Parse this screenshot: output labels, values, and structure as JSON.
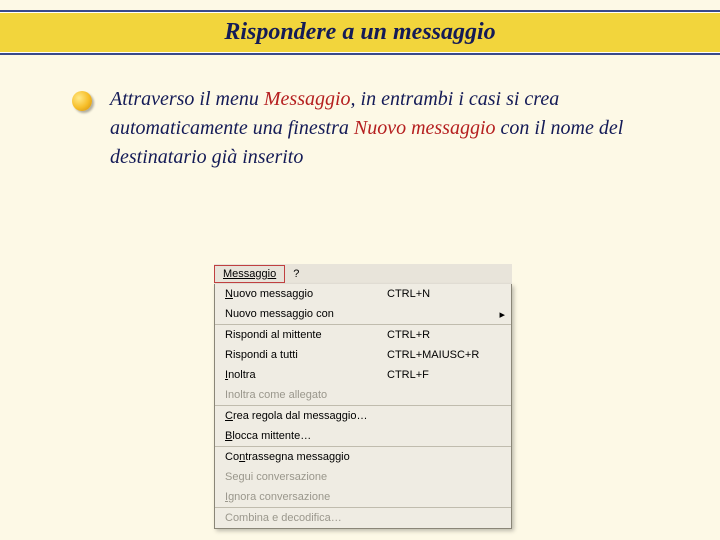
{
  "title": "Rispondere a un messaggio",
  "para": {
    "p1": "Attraverso il menu ",
    "hl1": "Messaggio",
    "p2": ", in entrambi i casi si crea automaticamente una finestra ",
    "hl2": "Nuovo messaggio",
    "p3": " con il nome del destinatario già inserito"
  },
  "menubar": {
    "tab": "Messaggio",
    "help": "?"
  },
  "menu": {
    "sec1": {
      "l0": "N",
      "l0b": "uovo messaggio",
      "l0sc": "CTRL+N",
      "l1": "Nuovo messaggio con",
      "arr": "▸"
    },
    "sec2": {
      "l0": "Rispondi al mittente",
      "l0sc": "CTRL+R",
      "l1": "Rispondi a tutti",
      "l1sc": "CTRL+MAIUSC+R",
      "l2a": "I",
      "l2b": "noltra",
      "l2sc": "CTRL+F",
      "l3": "Inoltra come allegato"
    },
    "sec3": {
      "l0a": "C",
      "l0b": "rea regola dal messaggio…",
      "l1a": "B",
      "l1b": "locca mittente…"
    },
    "sec4": {
      "l0": "Co",
      "l0u": "n",
      "l0c": "trassegna messaggio",
      "l1": "Segui conversazione",
      "l2a": "I",
      "l2b": "gnora conversazione"
    },
    "sec5": {
      "l0": "Combina e decodifica…"
    }
  }
}
